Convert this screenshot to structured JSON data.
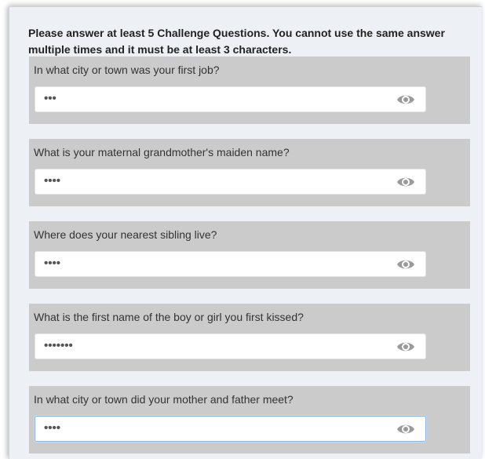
{
  "instructions": "Please answer at least 5 Challenge Questions. You cannot use the same answer multiple times and it must be at least 3 characters.",
  "questions": [
    {
      "label": "In what city or town was your first job?",
      "masked_answer": "•••",
      "focused": false
    },
    {
      "label": "What is your maternal grandmother's maiden name?",
      "masked_answer": "••••",
      "focused": false
    },
    {
      "label": "Where does your nearest sibling live?",
      "masked_answer": "••••",
      "focused": false
    },
    {
      "label": "What is the first name of the boy or girl you first kissed?",
      "masked_answer": "•••••••",
      "focused": false
    },
    {
      "label": "In what city or town did your mother and father meet?",
      "masked_answer": "••••",
      "focused": true
    }
  ],
  "icons": {
    "reveal": "eye-icon"
  },
  "colors": {
    "question_box": "#cbcbcb",
    "panel": "#edf0f4",
    "eye": "#9a9a9a",
    "focus": "#8ab4e8"
  }
}
